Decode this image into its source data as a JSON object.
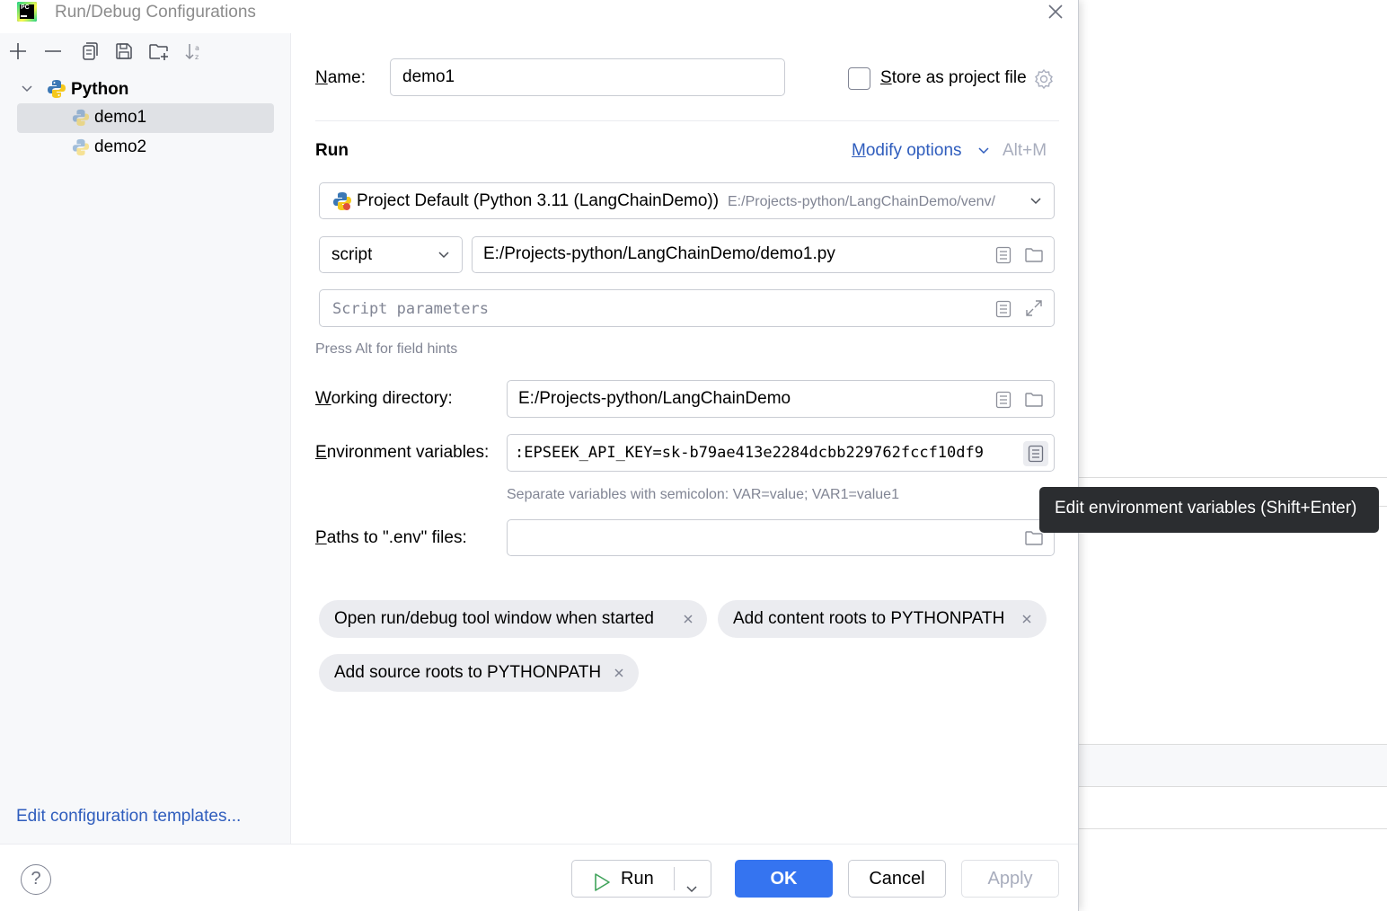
{
  "window": {
    "title": "Run/Debug Configurations"
  },
  "sidebar": {
    "toolbar_icons": [
      "plus-icon",
      "minus-icon",
      "copy-icon",
      "save-icon",
      "new-folder-icon",
      "sort-icon"
    ],
    "tree": {
      "group_label": "Python",
      "items": [
        {
          "label": "demo1",
          "selected": true
        },
        {
          "label": "demo2",
          "selected": false
        }
      ]
    },
    "edit_templates_link": "Edit configuration templates..."
  },
  "form": {
    "name_label": "Name:",
    "name_value": "demo1",
    "store_as_project_file_label": "Store as project file",
    "store_as_project_file_checked": false,
    "run_section_title": "Run",
    "modify_options_label": "Modify options",
    "modify_options_shortcut": "Alt+M",
    "interpreter_main": "Project Default (Python 3.11 (LangChainDemo))",
    "interpreter_path": "E:/Projects-python/LangChainDemo/venv/",
    "run_type_value": "script",
    "script_path_value": "E:/Projects-python/LangChainDemo/demo1.py",
    "script_parameters_placeholder": "Script parameters",
    "field_hints_text": "Press Alt for field hints",
    "working_directory_label": "Working directory:",
    "working_directory_value": "E:/Projects-python/LangChainDemo",
    "env_variables_label": "Environment variables:",
    "env_variables_value": ":EPSEEK_API_KEY=sk-b79ae413e2284dcbb229762fccf10df9",
    "env_variables_hint": "Separate variables with semicolon: VAR=value; VAR1=value1",
    "env_files_label": "Paths to \".env\" files:",
    "env_files_value": "",
    "options_chips": [
      "Open run/debug tool window when started",
      "Add content roots to PYTHONPATH",
      "Add source roots to PYTHONPATH"
    ]
  },
  "tooltip": {
    "text": "Edit environment variables (Shift+Enter)"
  },
  "footer": {
    "help_label": "?",
    "run_label": "Run",
    "ok_label": "OK",
    "cancel_label": "Cancel",
    "apply_label": "Apply",
    "apply_enabled": false
  },
  "colors": {
    "accent": "#3574f0",
    "link": "#2f5dbd",
    "tooltip_bg": "#2b2d30",
    "selection_bg": "#dfe1e5",
    "chip_bg": "#ebecf0"
  }
}
